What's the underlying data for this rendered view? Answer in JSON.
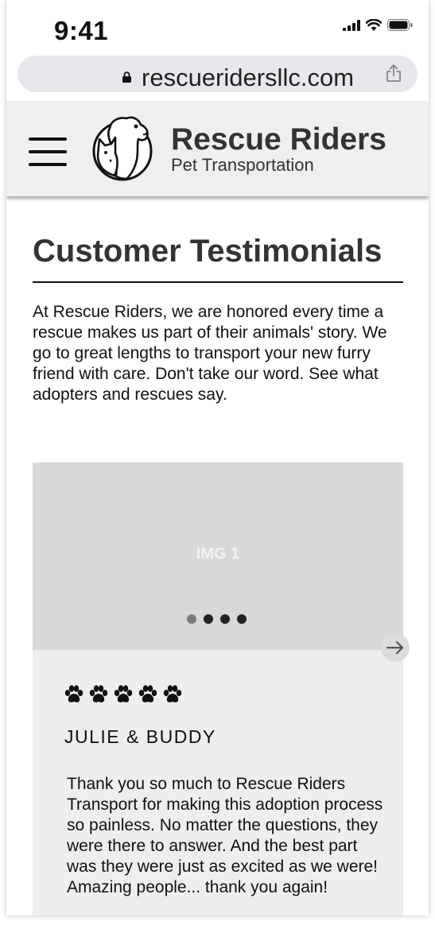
{
  "status": {
    "time": "9:41"
  },
  "browser": {
    "url": "rescueridersllc.com"
  },
  "header": {
    "brand": "Rescue Riders",
    "tagline": "Pet Transportation"
  },
  "page": {
    "title": "Customer Testimonials",
    "intro": "At Rescue Riders, we are honored every time a rescue makes us part of their animals' story. We go to great lengths to transport your new furry friend with care. Don't take our word. See what adopters and rescues say."
  },
  "carousel": {
    "image_label": "IMG 1",
    "slide_count": 4,
    "active_slide": 1
  },
  "testimonial": {
    "rating": 5,
    "name": "JULIE & BUDDY",
    "text": "Thank you so much to Rescue Riders Transport for making this adoption process so painless. No matter the questions, they were there to answer. And the best part was they were just as excited as we were! Amazing people... thank you again!"
  },
  "colors": {
    "header_bg": "#efefef",
    "carousel_bg": "#d8d8d8",
    "card_bg": "#eeeeee",
    "text": "#333333"
  },
  "icons": [
    "signal-icon",
    "wifi-icon",
    "battery-icon",
    "lock-icon",
    "share-icon",
    "hamburger-menu-icon",
    "logo-dog-cat-icon",
    "paw-icon",
    "arrow-right-icon"
  ]
}
